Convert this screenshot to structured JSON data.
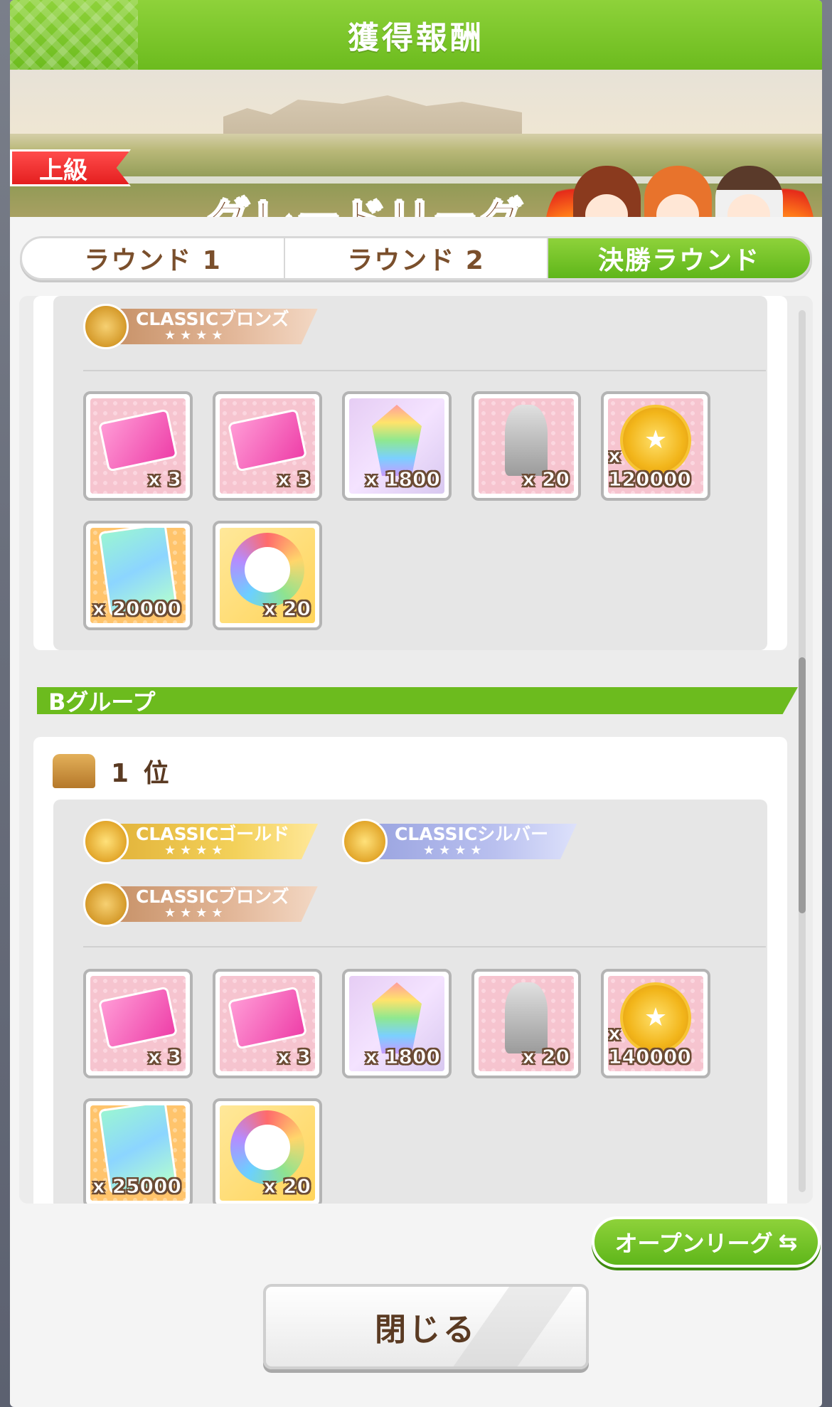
{
  "title": "獲得報酬",
  "banner": {
    "rank": "上級",
    "league": "グレードリーグ"
  },
  "tabs": [
    {
      "label": "ラウンド 1"
    },
    {
      "label": "ラウンド 2"
    },
    {
      "label": "決勝ラウンド",
      "active": true
    }
  ],
  "section_a": {
    "tier": {
      "name": "CLASSICブロンズ",
      "stars": "★★★★"
    },
    "items": [
      {
        "icon": "pink-ticket-icon",
        "qty": "x 3"
      },
      {
        "icon": "pink-ticket-icon",
        "qty": "x 3"
      },
      {
        "icon": "rainbow-crystal-icon",
        "qty": "x 1800"
      },
      {
        "icon": "silver-statue-icon",
        "qty": "x 20"
      },
      {
        "icon": "gold-coin-icon",
        "qty": "x 120000"
      },
      {
        "icon": "rainbow-card-icon",
        "qty": "x 20000"
      },
      {
        "icon": "rainbow-horseshoe-icon",
        "qty": "x 20"
      }
    ]
  },
  "group_b": {
    "label": "Bグループ",
    "rank": "1 位",
    "tiers": [
      {
        "name": "CLASSICゴールド",
        "stars": "★★★★"
      },
      {
        "name": "CLASSICシルバー",
        "stars": "★★★★"
      },
      {
        "name": "CLASSICブロンズ",
        "stars": "★★★★"
      }
    ],
    "items": [
      {
        "icon": "pink-ticket-icon",
        "qty": "x 3"
      },
      {
        "icon": "pink-ticket-icon",
        "qty": "x 3"
      },
      {
        "icon": "rainbow-crystal-icon",
        "qty": "x 1800"
      },
      {
        "icon": "silver-statue-icon",
        "qty": "x 20"
      },
      {
        "icon": "gold-coin-icon",
        "qty": "x 140000"
      },
      {
        "icon": "rainbow-card-icon",
        "qty": "x 25000"
      },
      {
        "icon": "rainbow-horseshoe-icon",
        "qty": "x 20"
      }
    ]
  },
  "buttons": {
    "open_league": "オープンリーグ",
    "swap_icon": "⇆",
    "close": "閉じる"
  },
  "colors": {
    "accent_green": "#6cbb1e",
    "rank_red": "#e41f1f",
    "text_brown": "#5a3a22"
  }
}
